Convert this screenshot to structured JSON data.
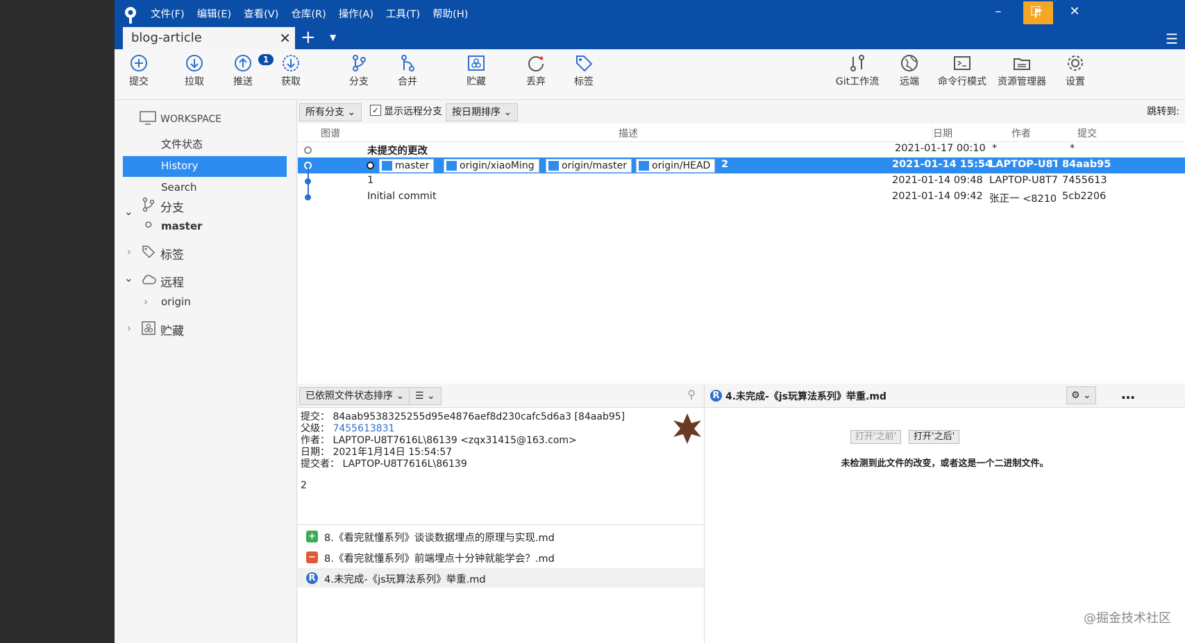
{
  "menu": [
    "文件(F)",
    "编辑(E)",
    "查看(V)",
    "仓库(R)",
    "操作(A)",
    "工具(T)",
    "帮助(H)"
  ],
  "tab": {
    "label": "blog-article"
  },
  "toolbar": {
    "commit": "提交",
    "commit_badge": "1",
    "pull": "拉取",
    "push": "推送",
    "fetch": "获取",
    "branch": "分支",
    "merge": "合并",
    "stash": "贮藏",
    "discard": "丢弃",
    "tag": "标签",
    "gitflow": "Git工作流",
    "remote": "远端",
    "terminal": "命令行模式",
    "explorer": "资源管理器",
    "settings": "设置"
  },
  "sidebar": {
    "workspace": "WORKSPACE",
    "file_status": "文件状态",
    "history": "History",
    "search": "Search",
    "branches": "分支",
    "branch_master": "master",
    "tags": "标签",
    "remotes": "远程",
    "remote_origin": "origin",
    "stashes": "贮藏"
  },
  "filter": {
    "branches": "所有分支",
    "show_remote": "显示远程分支",
    "sort": "按日期排序",
    "jump": "跳转到:"
  },
  "columns": {
    "graph": "图谱",
    "desc": "描述",
    "date": "日期",
    "author": "作者",
    "commit": "提交"
  },
  "commits": [
    {
      "desc": "未提交的更改",
      "date": "2021-01-17 00:10",
      "author": "*",
      "hash": "*"
    },
    {
      "desc": "2",
      "date": "2021-01-14 15:54",
      "author": "LAPTOP-U8T",
      "hash": "84aab95",
      "refs": [
        "master",
        "origin/xiaoMing",
        "origin/master",
        "origin/HEAD"
      ]
    },
    {
      "desc": "1",
      "date": "2021-01-14 09:48",
      "author": "LAPTOP-U8T7",
      "hash": "7455613"
    },
    {
      "desc": "Initial commit",
      "date": "2021-01-14 09:42",
      "author": "张正一 <8210",
      "hash": "5cb2206"
    }
  ],
  "detail": {
    "sort": "已依照文件状态排序",
    "commit_label": "提交：",
    "commit": "84aab9538325255d95e4876aef8d230cafc5d6a3 [84aab95]",
    "parent_label": "父级：",
    "parent": "7455613831",
    "author_label": "作者：",
    "author": "LAPTOP-U8T7616L\\86139 <zqx31415@163.com>",
    "date_label": "日期：",
    "date": "2021年1月14日 15:54:57",
    "committer_label": "提交者：",
    "committer": "LAPTOP-U8T7616L\\86139",
    "message": "2"
  },
  "files": [
    {
      "name": "8.《看完就懂系列》谈谈数据埋点的原理与实现.md",
      "status": "added"
    },
    {
      "name": "8.《看完就懂系列》前端埋点十分钟就能学会？.md",
      "status": "removed"
    },
    {
      "name": "4.未完成-《js玩算法系列》举重.md",
      "status": "renamed"
    }
  ],
  "diff": {
    "file": "4.未完成-《js玩算法系列》举重.md",
    "open_before": "打开'之前'",
    "open_after": "打开'之后'",
    "message": "未检测到此文件的改变，或者这是一个二进制文件。"
  },
  "watermark": "@掘金技术社区",
  "colors": {
    "brand": "#0a4ea8",
    "selection": "#2d8cf0",
    "flag": "#f5a623"
  }
}
